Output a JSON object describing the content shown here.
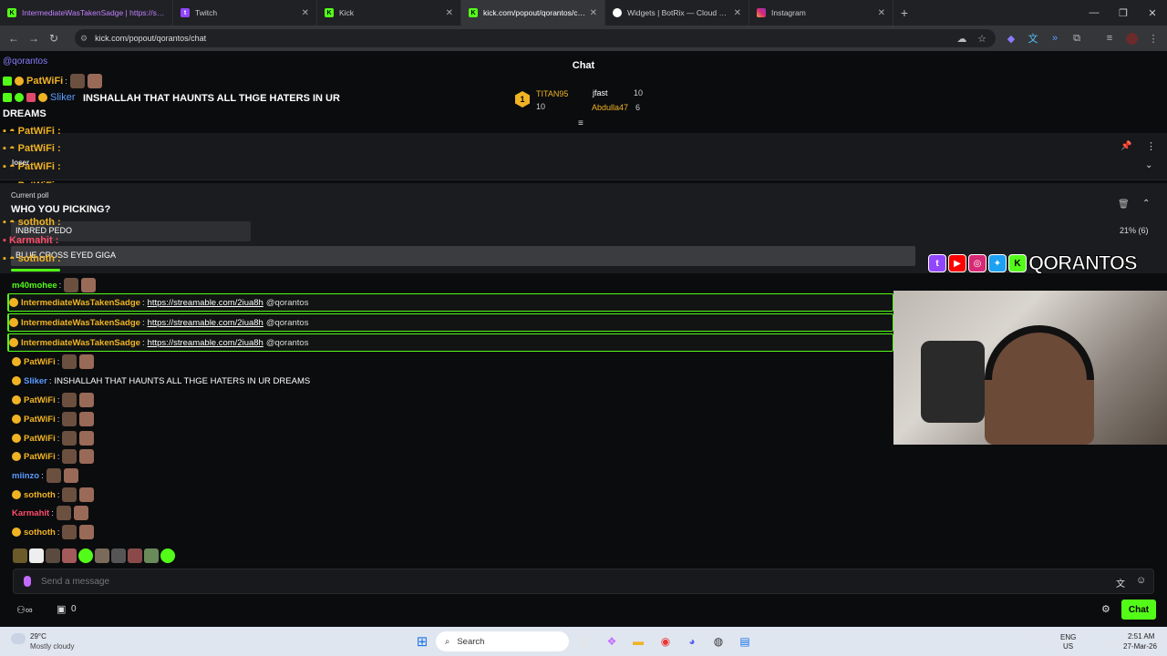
{
  "browser": {
    "tabs": [
      {
        "label": "IntermediateWasTakenSadge | https://streamable.com/2iua8h",
        "active": false
      },
      {
        "label": "Twitch",
        "active": false
      },
      {
        "label": "Kick",
        "active": false
      },
      {
        "label": "kick.com/popout/qorantos/chat",
        "active": true
      },
      {
        "label": "Widgets | BotRix — Cloud Stre…",
        "active": false
      },
      {
        "label": "Instagram",
        "active": false
      }
    ],
    "url": "kick.com/popout/qorantos/chat"
  },
  "overlay": {
    "line1": "@qorantos",
    "line2": "IntermediateWasTakenSadge : https://streamable.com/2iua8h",
    "line3": "@qorantos",
    "who_label": "WHO YOU PICKING?",
    "loser_label": "loser",
    "current_poll": "Current poll",
    "inbred": "INBRED PEDO",
    "blue_eyed": "BLUE CROSS EYED GIGA"
  },
  "chat": {
    "title": "Chat",
    "mention": "@qorantos",
    "top_messages": [
      {
        "user": "PatWiFi",
        "text": ""
      },
      {
        "user": "Sliker",
        "text": "INSHALLAH THAT HAUNTS ALL THGE HATERS IN UR DREAMS"
      }
    ],
    "leaderboard": {
      "rank1": "1",
      "user1": "TITAN95",
      "user1_count": "10",
      "user2": "jfast",
      "user2_count": "10",
      "user3": "Abdulla47",
      "user3_count": "6"
    },
    "poll": {
      "pct": "21% (6)",
      "option1": "INBRED PEDO",
      "option2": "BLUE CROSS EYED GIGA"
    },
    "messages": [
      {
        "user": "m40mohee",
        "color": "#53fc18",
        "text": "",
        "link": "",
        "suffix": "",
        "hl": false
      },
      {
        "user": "IntermediateWasTakenSadge",
        "color": "#f0b323",
        "text": "",
        "link": "https://streamable.com/2iua8h",
        "suffix": "@qorantos",
        "hl": true
      },
      {
        "user": "IntermediateWasTakenSadge",
        "color": "#f0b323",
        "text": "",
        "link": "https://streamable.com/2iua8h",
        "suffix": "@qorantos",
        "hl": true
      },
      {
        "user": "IntermediateWasTakenSadge",
        "color": "#f0b323",
        "text": "",
        "link": "https://streamable.com/2iua8h",
        "suffix": "@qorantos",
        "hl": true
      },
      {
        "user": "PatWiFi",
        "color": "#f0b323",
        "text": "",
        "link": "",
        "suffix": "",
        "hl": false
      },
      {
        "user": "Sliker",
        "color": "#5a9bff",
        "text": "INSHALLAH THAT HAUNTS ALL THGE HATERS IN UR DREAMS",
        "link": "",
        "suffix": "",
        "hl": false
      },
      {
        "user": "PatWiFi",
        "color": "#f0b323",
        "text": "",
        "link": "",
        "suffix": "",
        "hl": false
      },
      {
        "user": "PatWiFi",
        "color": "#f0b323",
        "text": "",
        "link": "",
        "suffix": "",
        "hl": false
      },
      {
        "user": "PatWiFi",
        "color": "#f0b323",
        "text": "",
        "link": "",
        "suffix": "",
        "hl": false
      },
      {
        "user": "PatWiFi",
        "color": "#f0b323",
        "text": "",
        "link": "",
        "suffix": "",
        "hl": false
      },
      {
        "user": "miinzo",
        "color": "#5a9bff",
        "text": "",
        "link": "",
        "suffix": "",
        "hl": false
      },
      {
        "user": "sothoth",
        "color": "#f0b323",
        "text": "",
        "link": "",
        "suffix": "",
        "hl": false
      },
      {
        "user": "Karmahit",
        "color": "#ff4d6a",
        "text": "",
        "link": "",
        "suffix": "",
        "hl": false
      },
      {
        "user": "sothoth",
        "color": "#f0b323",
        "text": "",
        "link": "",
        "suffix": "",
        "hl": false
      }
    ],
    "input_placeholder": "Send a message",
    "send_label": "Chat",
    "viewer_count": "0"
  },
  "stream": {
    "logo_text": "QORANTOS"
  },
  "taskbar": {
    "temp": "29°C",
    "weather": "Mostly cloudy",
    "search": "Search",
    "lang1": "ENG",
    "lang2": "US",
    "time": "2:51 AM",
    "date": "27-Mar-26"
  },
  "colors": {
    "kick_green": "#53fc18",
    "gold": "#f0b323",
    "blue_name": "#5a9bff"
  }
}
